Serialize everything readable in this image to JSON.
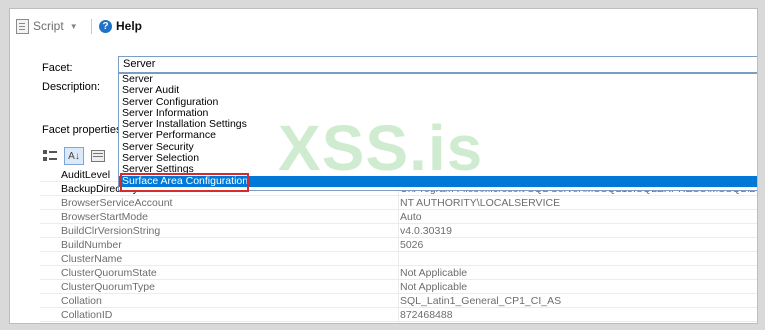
{
  "toolbar": {
    "script_label": "Script",
    "help_label": "Help",
    "help_glyph": "?"
  },
  "labels": {
    "facet": "Facet:",
    "description": "Description:",
    "facet_properties": "Facet properties:"
  },
  "facet": {
    "selected": "Server",
    "options": [
      "Server",
      "Server Audit",
      "Server Configuration",
      "Server Information",
      "Server Installation Settings",
      "Server Performance",
      "Server Security",
      "Server Selection",
      "Server Settings",
      "Surface Area Configuration"
    ],
    "highlighted_index": 9
  },
  "property_toolbar": {
    "sort_glyph": "A↓"
  },
  "properties": [
    {
      "name": "AuditLevel",
      "value": ""
    },
    {
      "name": "BackupDirectory",
      "value": "C:\\Program Files\\Microsoft SQL Server\\MSSQL15.SQLEXPRESS\\MSSQL\\Backup"
    },
    {
      "name": "BrowserServiceAccount",
      "value": "NT AUTHORITY\\LOCALSERVICE"
    },
    {
      "name": "BrowserStartMode",
      "value": "Auto"
    },
    {
      "name": "BuildClrVersionString",
      "value": "v4.0.30319"
    },
    {
      "name": "BuildNumber",
      "value": "5026"
    },
    {
      "name": "ClusterName",
      "value": ""
    },
    {
      "name": "ClusterQuorumState",
      "value": "Not Applicable"
    },
    {
      "name": "ClusterQuorumType",
      "value": "Not Applicable"
    },
    {
      "name": "Collation",
      "value": "SQL_Latin1_General_CP1_CI_AS"
    },
    {
      "name": "CollationID",
      "value": "872468488"
    }
  ],
  "watermark": "XSS.is",
  "colors": {
    "selection": "#0078d7",
    "highlight_box": "#d62b2b",
    "watermark": "#78c878"
  }
}
